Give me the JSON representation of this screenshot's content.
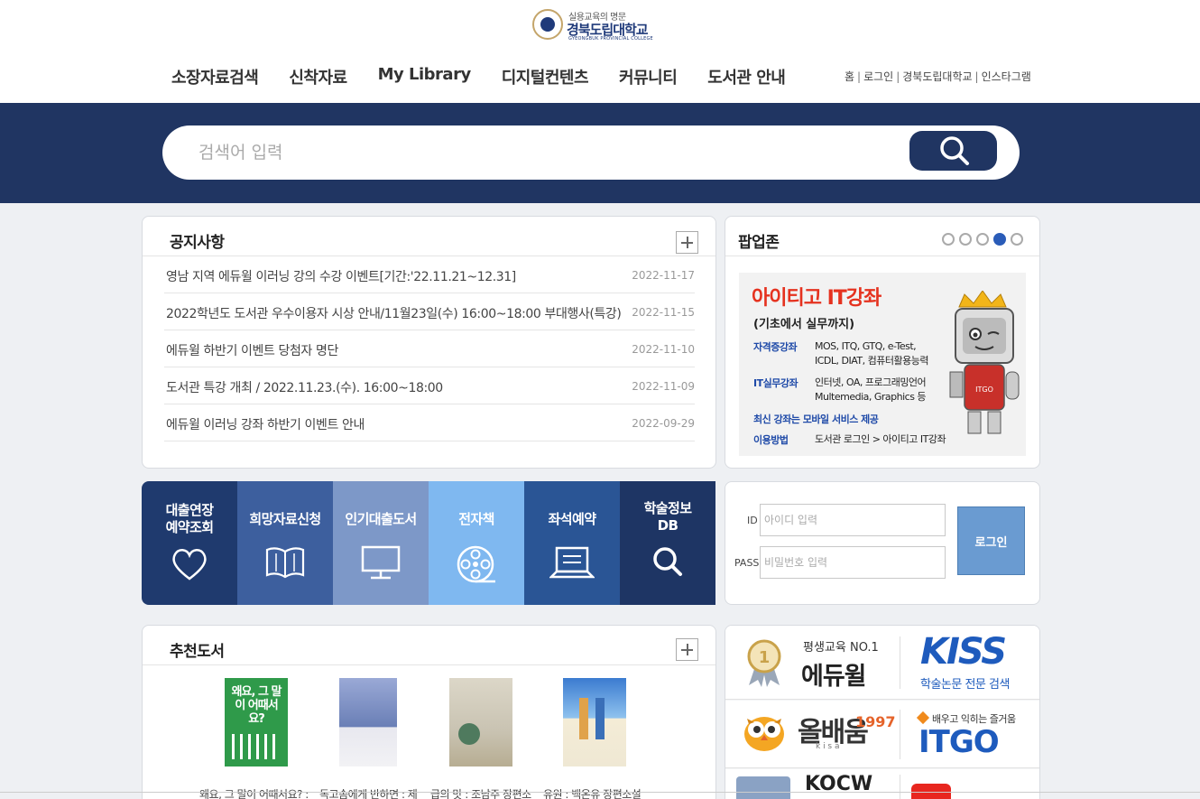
{
  "header": {
    "logo_sub": "실용교육의 명문",
    "logo_main": "경북도립대학교",
    "logo_eng": "GYEONGBUK PROVINCIAL COLLEGE",
    "nav": [
      "소장자료검색",
      "신착자료",
      "My Library",
      "디지털컨텐츠",
      "커뮤니티",
      "도서관 안내"
    ],
    "util": [
      "홈",
      "로그인",
      "경북도립대학교",
      "인스타그램"
    ]
  },
  "search": {
    "placeholder": "검색어 입력"
  },
  "notice": {
    "title": "공지사항",
    "items": [
      {
        "title": "영남 지역 에듀윌 이러닝 강의 수강 이벤트[기간:'22.11.21~12.31]",
        "date": "2022-11-17"
      },
      {
        "title": "2022학년도 도서관 우수이용자 시상 안내/11월23일(수) 16:00~18:00 부대행사(특강)",
        "date": "2022-11-15"
      },
      {
        "title": "에듀윌 하반기 이벤트 당첨자 명단",
        "date": "2022-11-10"
      },
      {
        "title": "도서관 특강 개최 / 2022.11.23.(수). 16:00~18:00",
        "date": "2022-11-09"
      },
      {
        "title": "에듀윌 이러닝 강좌 하반기 이벤트 안내",
        "date": "2022-09-29"
      }
    ]
  },
  "popup": {
    "title": "팝업존",
    "active_dot": 4,
    "dot_count": 5,
    "banner": {
      "headline": "아이티고 IT강좌",
      "sub": "(기초에서 실무까지)",
      "rows": [
        {
          "k": "자격증강좌",
          "v1": "MOS, ITQ, GTQ, e-Test,",
          "v2": "ICDL, DIAT, 컴퓨터활용능력"
        },
        {
          "k": "IT실무강좌",
          "v1": "인터넷, OA, 프로그래밍언어",
          "v2": "Multemedia, Graphics 등"
        },
        {
          "k": "최신 강좌는 모바일 서비스 제공",
          "v1": "",
          "v2": ""
        },
        {
          "k": "이용방법",
          "v1": "도서관 로그인 > 아이티고 IT강좌",
          "v2": ""
        }
      ],
      "mascot_badge": "ITGO"
    }
  },
  "quick": [
    {
      "label1": "대출연장",
      "label2": "예약조회",
      "icon": "heart-icon",
      "color": "#1f3a6e"
    },
    {
      "label1": "희망자료신청",
      "label2": "",
      "icon": "open-book-icon",
      "color": "#3d5f9e"
    },
    {
      "label1": "인기대출도서",
      "label2": "",
      "icon": "monitor-icon",
      "color": "#7d98c8"
    },
    {
      "label1": "전자책",
      "label2": "",
      "icon": "film-reel-icon",
      "color": "#7fb8f0"
    },
    {
      "label1": "좌석예약",
      "label2": "",
      "icon": "laptop-icon",
      "color": "#2a5595"
    },
    {
      "label1": "학술정보",
      "label2": "DB",
      "icon": "search-icon",
      "color": "#1e3564"
    }
  ],
  "login": {
    "id_label": "ID",
    "id_placeholder": "아이디 입력",
    "pass_label": "PASS",
    "pass_placeholder": "비밀번호 입력",
    "button": "로그인"
  },
  "books": {
    "title": "추천도서",
    "items": [
      {
        "cover_text": "왜요, 그 말이 어때서요?",
        "caption": "왜요, 그 말이 어때서요? :",
        "color": "#2f9a4a"
      },
      {
        "cover_text": "",
        "caption": "독고솜에게 반하면 : 제",
        "color": "#6a7fb6"
      },
      {
        "cover_text": "",
        "caption": "급의 맛 : 조남주 장편소",
        "color": "#c9c3b2"
      },
      {
        "cover_text": "",
        "caption": "유원 : 백온유 장편소설",
        "color": "#3b7bd0"
      }
    ]
  },
  "links": {
    "edu_sub": "평생교육 NO.1",
    "edu_main": "에듀윌",
    "kiss_main": "KISS",
    "kiss_sub": "학술논문 전문 검색",
    "kisa_main": "올배움",
    "kisa_year": "1997",
    "kisa_sub": "k i s a",
    "itgo_sub": "배우고 익히는 즐거움",
    "itgo_main": "ITGO",
    "kocw": "KOCW"
  },
  "colors": {
    "navy": "#203562",
    "accent_blue": "#2a5cb8",
    "itgo_red": "#e5321f"
  }
}
